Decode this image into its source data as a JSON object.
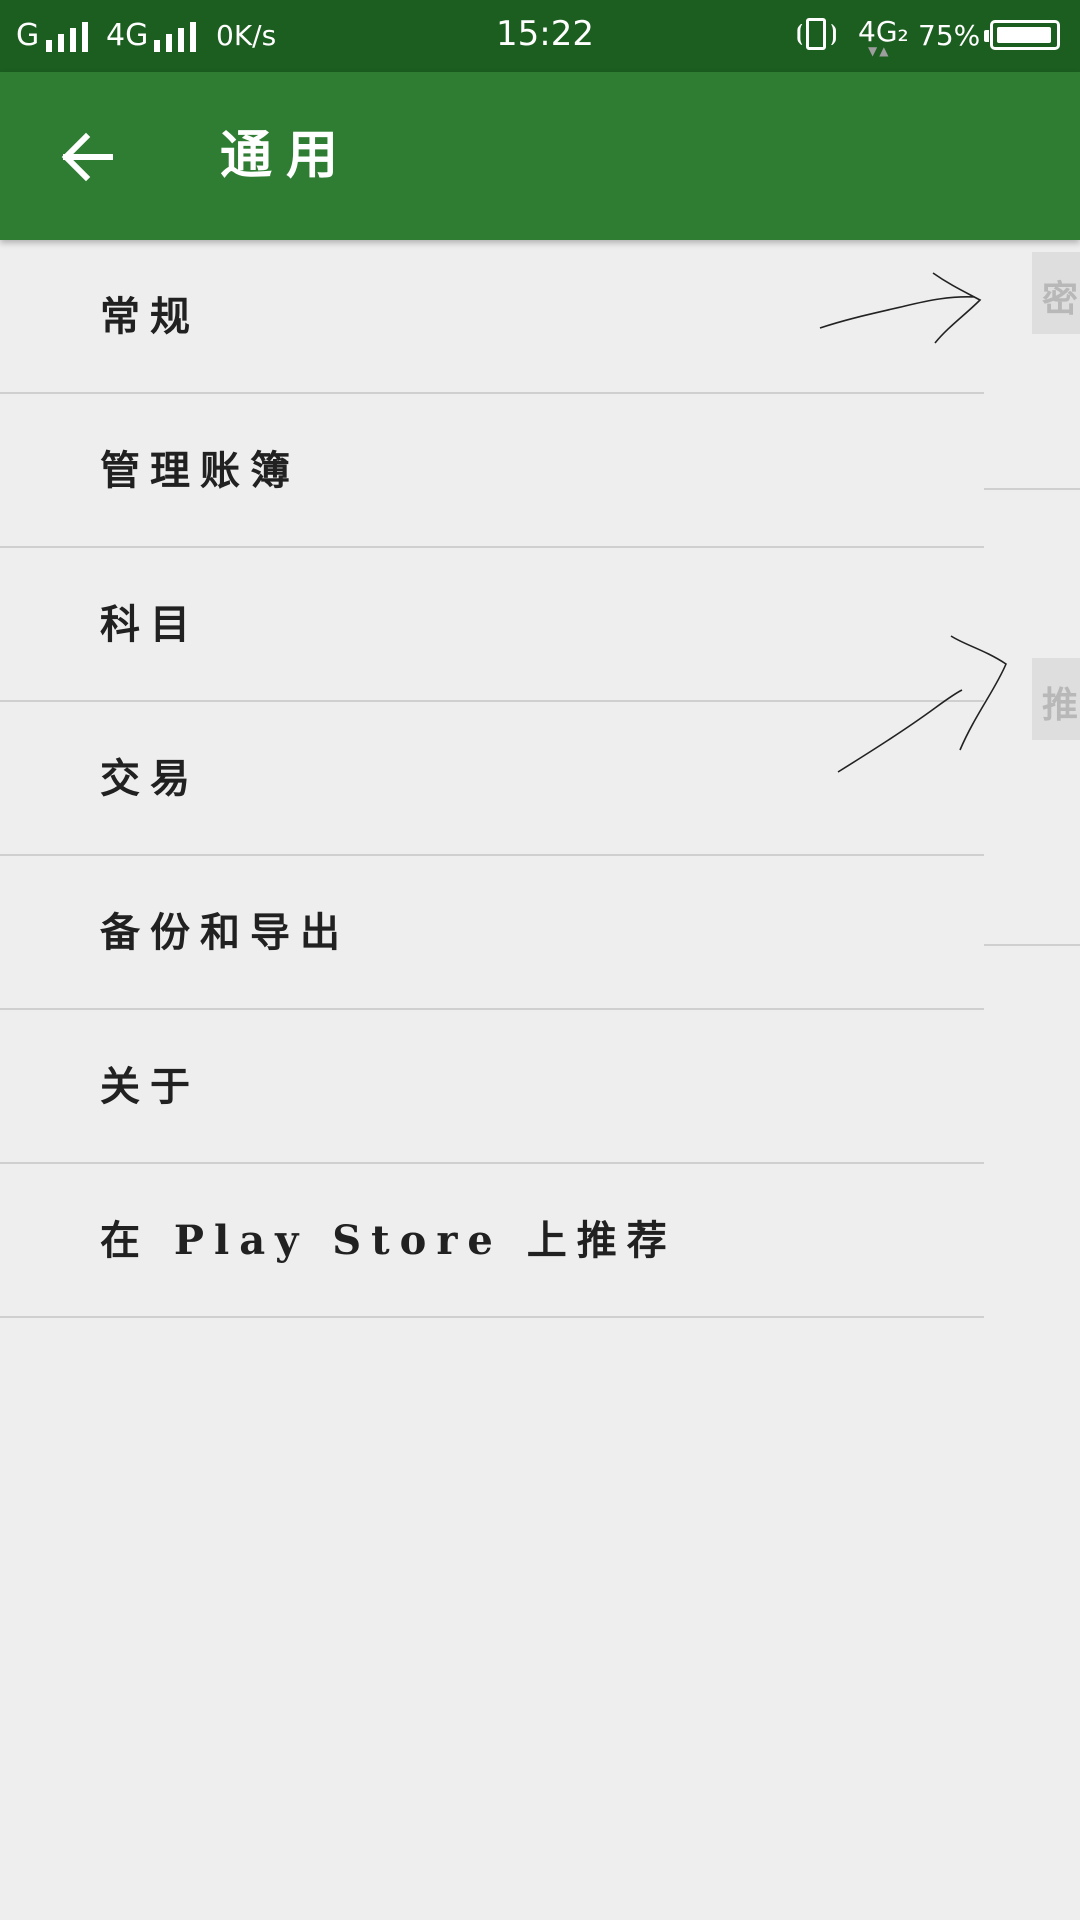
{
  "status_bar": {
    "signal1_label": "G",
    "signal2_label": "4G",
    "data_rate": "0K/s",
    "time": "15:22",
    "network_secondary": "4G₂",
    "battery_percent": "75%"
  },
  "app_bar": {
    "title": "通用"
  },
  "menu": {
    "items": [
      {
        "label": "常规"
      },
      {
        "label": "管理账簿"
      },
      {
        "label": "科目"
      },
      {
        "label": "交易"
      },
      {
        "label": "备份和导出"
      },
      {
        "label": "关于"
      },
      {
        "label": "在 Play Store 上推荐"
      }
    ]
  },
  "side_panel": {
    "button1_text": "密",
    "button2_text": "推"
  },
  "colors": {
    "status_bar_bg": "#1b5e20",
    "app_bar_bg": "#2e7d32",
    "page_bg": "#eeeeee",
    "divider": "#cfcfcf"
  },
  "icons": {
    "back": "arrow-left-icon",
    "vibrate": "vibrate-icon",
    "battery": "battery-icon",
    "signal": "signal-bars-icon"
  }
}
